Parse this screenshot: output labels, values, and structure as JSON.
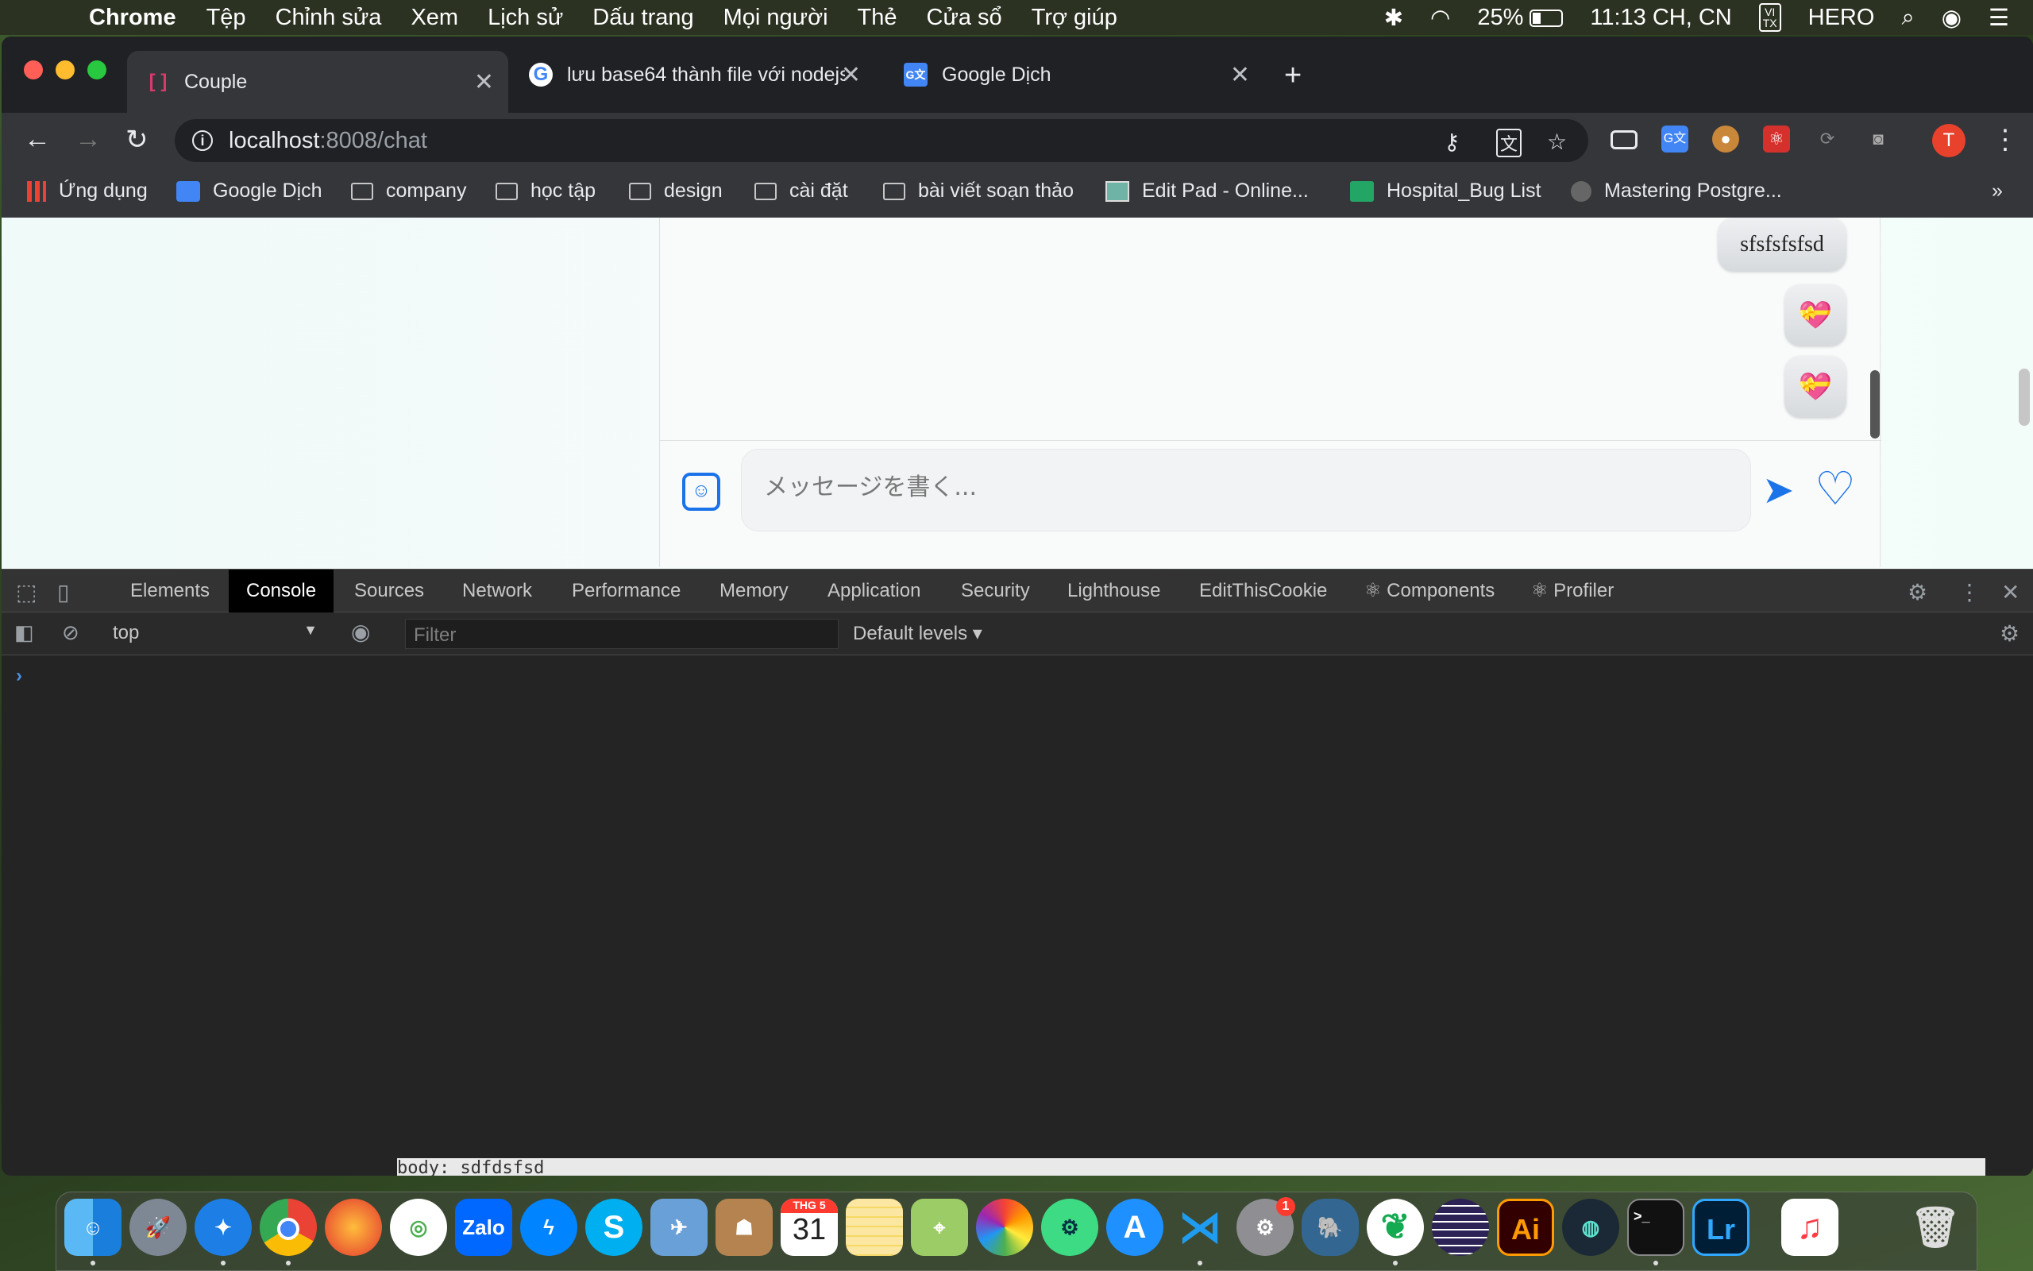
{
  "menubar": {
    "app_name": "Chrome",
    "items": [
      "Tệp",
      "Chỉnh sửa",
      "Xem",
      "Lịch sử",
      "Dấu trang",
      "Mọi người",
      "Thẻ",
      "Cửa sổ",
      "Trợ giúp"
    ],
    "battery": "25%",
    "clock": "11:13 CH, CN",
    "input_method": "VI\nTX",
    "user": "HERO"
  },
  "tabs": [
    {
      "title": "Couple",
      "favicon": "[ ]",
      "active": true
    },
    {
      "title": "lưu base64 thành file với nodejs",
      "favicon": "G",
      "active": false
    },
    {
      "title": "Google Dịch",
      "favicon": "G文",
      "active": false
    }
  ],
  "omnibox": {
    "host": "localhost",
    "path": ":8008/chat"
  },
  "profile_initial": "T",
  "bookmarks": [
    {
      "label": "Ứng dụng",
      "icon": "apps-grid-icon"
    },
    {
      "label": "Google Dịch",
      "icon": "google-translate-icon"
    },
    {
      "label": "company",
      "icon": "folder-icon"
    },
    {
      "label": "học tập",
      "icon": "folder-icon"
    },
    {
      "label": "design",
      "icon": "folder-icon"
    },
    {
      "label": "cài đặt",
      "icon": "folder-icon"
    },
    {
      "label": "bài viết soạn thảo",
      "icon": "folder-icon"
    },
    {
      "label": "Edit Pad - Online...",
      "icon": "editpad-icon"
    },
    {
      "label": "Hospital_Bug List",
      "icon": "sheets-icon"
    },
    {
      "label": "Mastering Postgre...",
      "icon": "site-icon"
    }
  ],
  "bookmarks_overflow": "»",
  "chat": {
    "last_text_message": "sfsfsfsfsd",
    "heart_stickers": 2,
    "input_placeholder": "メッセージを書く..."
  },
  "devtools": {
    "tabs": [
      "Elements",
      "Console",
      "Sources",
      "Network",
      "Performance",
      "Memory",
      "Application",
      "Security",
      "Lighthouse",
      "EditThisCookie",
      "⚛ Components",
      "⚛ Profiler"
    ],
    "active_tab": "Console",
    "context": "top",
    "filter_placeholder": "Filter",
    "levels": "Default levels ▾",
    "prompt": "›"
  },
  "behind_text": "body: sdfdsfsd",
  "dock": {
    "calendar_month": "THG 5",
    "calendar_day": "31",
    "settings_badge": "1",
    "apps": [
      "Finder",
      "Launchpad",
      "Safari",
      "Chrome",
      "Firefox",
      "CocCoc",
      "Zalo",
      "Messenger",
      "Skype",
      "Preview",
      "Contacts",
      "Calendar",
      "Notes",
      "Maps",
      "Photos",
      "Android Studio",
      "App Store",
      "VS Code",
      "System Preferences",
      "PostgreSQL",
      "MongoDB",
      "Eclipse",
      "Illustrator",
      "GitKraken",
      "Terminal",
      "Lightroom",
      "Music",
      "Trash"
    ]
  }
}
